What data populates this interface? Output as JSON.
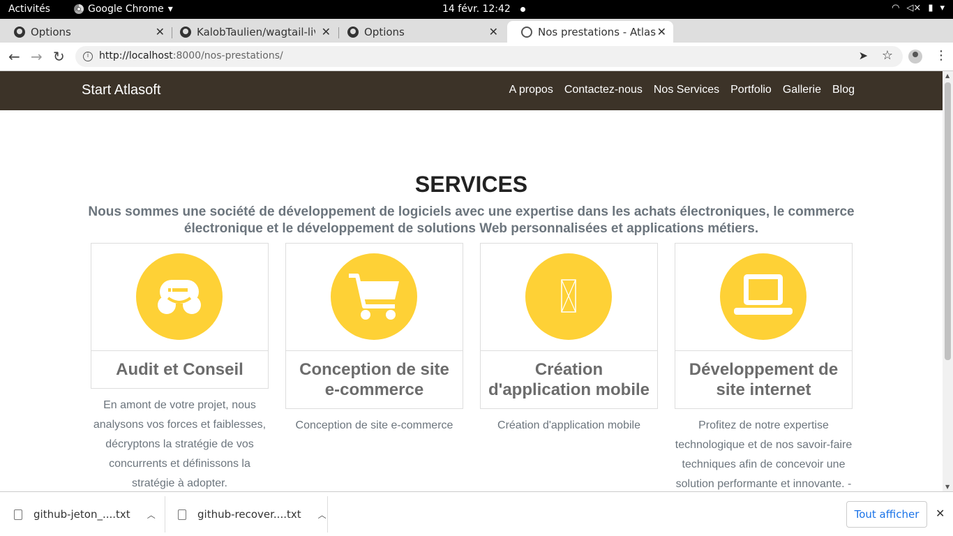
{
  "system_bar": {
    "activities": "Activités",
    "app_name": "Google Chrome",
    "clock": "14 févr.  12:42"
  },
  "tabs": [
    {
      "title": "Options"
    },
    {
      "title": "KalobTaulien/wagtail-live"
    },
    {
      "title": "Options"
    },
    {
      "title": "Nos prestations - Atlas RD"
    }
  ],
  "toolbar": {
    "url_host": "http://localhost",
    "url_path": ":8000/nos-prestations/"
  },
  "site": {
    "brand": "Start Atlasoft",
    "menu": [
      "A propos",
      "Contactez-nous",
      "Nos Services",
      "Portfolio",
      "Gallerie",
      "Blog"
    ]
  },
  "services": {
    "heading": "SERVICES",
    "subheading": "Nous sommes une société de développement de logiciels avec une expertise dans les achats électroniques, le commerce électronique et le développement de solutions Web personnalisées et applications métiers.",
    "cards": [
      {
        "icon": "wpbeginner-icon",
        "title": "Audit et Conseil",
        "description": "En amont de votre projet, nous analysons vos forces et faiblesses, décryptons la stratégie de vos concurrents et définissons la stratégie à adopter."
      },
      {
        "icon": "shopping-cart-icon",
        "title": "Conception de site e-commerce",
        "description": "Conception de site e-commerce"
      },
      {
        "icon": "mobile-placeholder-icon",
        "title": "Création d'application mobile",
        "description": "Création d'application mobile"
      },
      {
        "icon": "laptop-icon",
        "title": "Développement de site internet",
        "description": "Profitez de notre expertise technologique et de nos savoir-faire techniques afin de concevoir une solution performante et innovante. -"
      }
    ],
    "accent_color": "#fed136"
  },
  "downloads": {
    "items": [
      {
        "name": "github-jeton_....txt"
      },
      {
        "name": "github-recover....txt"
      }
    ],
    "show_all": "Tout afficher"
  }
}
